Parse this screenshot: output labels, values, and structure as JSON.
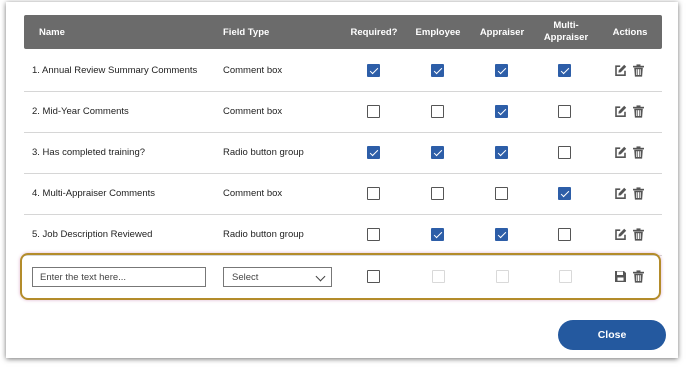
{
  "table": {
    "headers": {
      "name": "Name",
      "field_type": "Field Type",
      "required": "Required?",
      "employee": "Employee",
      "appraiser": "Appraiser",
      "multi_appraiser_line1": "Multi-",
      "multi_appraiser_line2": "Appraiser",
      "actions": "Actions"
    },
    "rows": [
      {
        "name": "1. Annual Review Summary Comments",
        "field_type": "Comment box",
        "required": true,
        "employee": true,
        "appraiser": true,
        "multi_appraiser": true
      },
      {
        "name": "2. Mid-Year Comments",
        "field_type": "Comment box",
        "required": false,
        "employee": false,
        "appraiser": true,
        "multi_appraiser": false
      },
      {
        "name": "3. Has completed training?",
        "field_type": "Radio button group",
        "required": true,
        "employee": true,
        "appraiser": true,
        "multi_appraiser": false
      },
      {
        "name": "4. Multi-Appraiser Comments",
        "field_type": "Comment box",
        "required": false,
        "employee": false,
        "appraiser": false,
        "multi_appraiser": true
      },
      {
        "name": "5. Job Description Reviewed",
        "field_type": "Radio button group",
        "required": false,
        "employee": true,
        "appraiser": true,
        "multi_appraiser": false
      }
    ]
  },
  "new_row": {
    "name_placeholder": "Enter the text here...",
    "field_type_value": "Select",
    "required": false
  },
  "footer": {
    "close_label": "Close"
  },
  "colors": {
    "header_bg": "#6b6b6b",
    "checkbox_checked": "#2d5ea8",
    "primary_button": "#24599f",
    "highlight_border": "#b38c2a"
  },
  "icons": {
    "edit": "edit-icon",
    "delete": "trash-icon",
    "save": "save-icon",
    "dropdown": "chevron-down-icon"
  }
}
